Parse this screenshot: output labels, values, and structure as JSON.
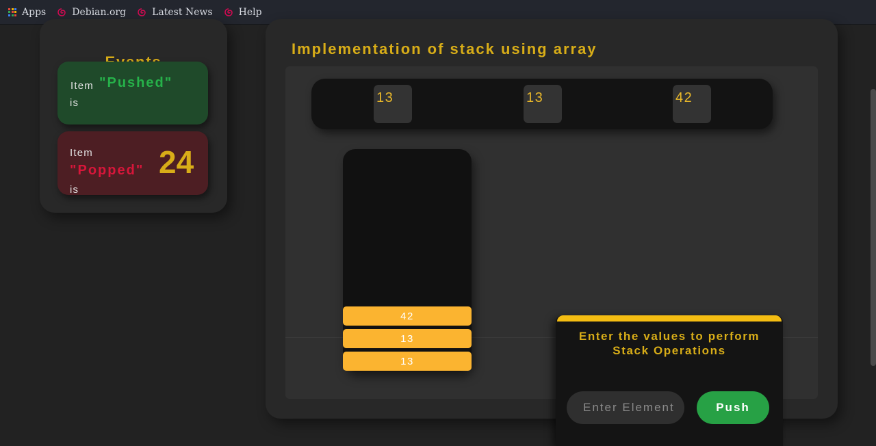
{
  "bookmarks": [
    {
      "label": "Apps",
      "icon": "apps-grid-icon"
    },
    {
      "label": "Debian.org",
      "icon": "debian-swirl-icon"
    },
    {
      "label": "Latest News",
      "icon": "debian-swirl-icon"
    },
    {
      "label": "Help",
      "icon": "debian-swirl-icon"
    }
  ],
  "events": {
    "title": "Events",
    "pushed": {
      "prefix": "Item",
      "word": "\"Pushed\"",
      "suffix": "is",
      "value": ""
    },
    "popped": {
      "prefix": "Item",
      "word": "\"Popped\"",
      "suffix": "is",
      "value": "24"
    }
  },
  "main": {
    "title": "Implementation of stack using array",
    "array_cells": [
      "13",
      "13",
      "42"
    ],
    "stack_items": [
      "42",
      "13",
      "13"
    ]
  },
  "operations": {
    "title_line1": "Enter the values to perform",
    "title_line2": "Stack Operations",
    "input_placeholder": "Enter Element",
    "push_label": "Push"
  },
  "colors": {
    "accent": "#d8ad18",
    "push_green": "#26b24a",
    "pop_red": "#d7163a",
    "stack_item": "#fbb430",
    "button_green": "#27a145"
  }
}
